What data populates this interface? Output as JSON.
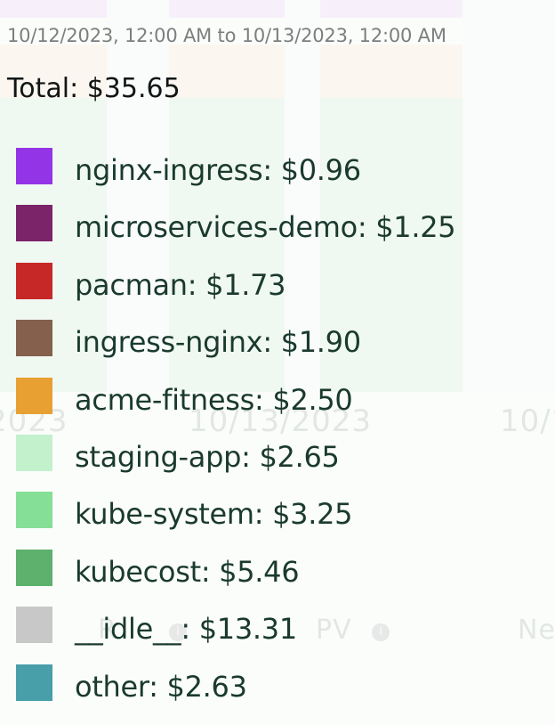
{
  "background": {
    "x_ticks": [
      "2023",
      "10/13/2023",
      "10/1"
    ],
    "tabs": [
      "R",
      "PV",
      "Ne"
    ]
  },
  "tooltip": {
    "range": "10/12/2023, 12:00 AM to 10/13/2023, 12:00 AM",
    "total": "Total: $35.65",
    "items": [
      {
        "label": "nginx-ingress: $0.96",
        "color": "#9334e6"
      },
      {
        "label": "microservices-demo: $1.25",
        "color": "#7b246a"
      },
      {
        "label": "pacman: $1.73",
        "color": "#c62828"
      },
      {
        "label": "ingress-nginx: $1.90",
        "color": "#85604d"
      },
      {
        "label": "acme-fitness: $2.50",
        "color": "#e8a033"
      },
      {
        "label": "staging-app: $2.65",
        "color": "#c2f1cc"
      },
      {
        "label": "kube-system: $3.25",
        "color": "#86df96"
      },
      {
        "label": "kubecost: $5.46",
        "color": "#5db16c"
      },
      {
        "label": "__idle__: $13.31",
        "color": "#c8c8c8"
      },
      {
        "label": "other: $2.63",
        "color": "#489fa9"
      }
    ]
  }
}
